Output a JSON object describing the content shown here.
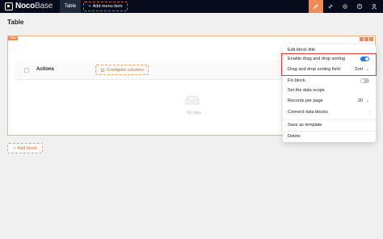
{
  "topbar": {
    "logo_bold": "Noco",
    "logo_light": "Base",
    "tab_label": "Table",
    "add_menu_label": "Add menu item",
    "accent_color": "#f18b54"
  },
  "page": {
    "title": "Table"
  },
  "block": {
    "tag": "Table",
    "columns": {
      "actions_label": "Actions",
      "configure_label": "Configure columns"
    },
    "empty_text": "No data"
  },
  "add_block_label": "Add block",
  "menu": {
    "edit_title": "Edit block title",
    "drag_sort": {
      "label": "Enable drag and drop sorting",
      "enabled": true
    },
    "drag_field": {
      "label": "Drag and drop sorting field",
      "value": "Sort"
    },
    "fix_block": {
      "label": "Fix block",
      "enabled": false
    },
    "data_scope": "Set the data scope",
    "records": {
      "label": "Records per page",
      "value": "20"
    },
    "connect": "Connect data blocks",
    "save_template": "Save as template",
    "delete": "Delete"
  }
}
